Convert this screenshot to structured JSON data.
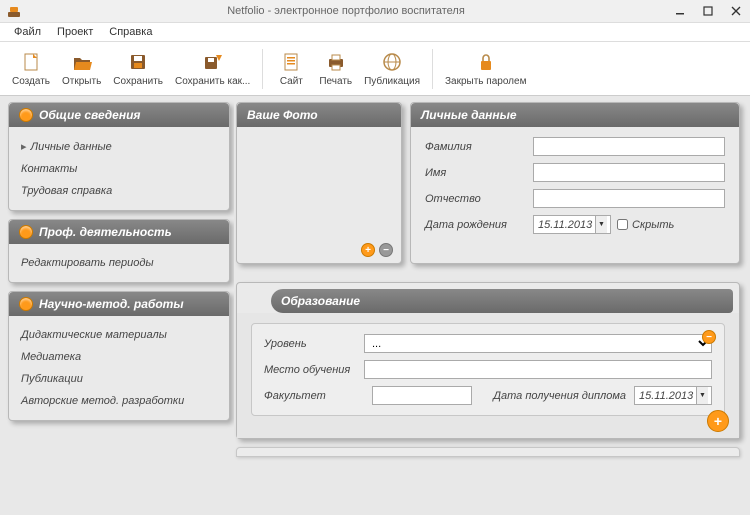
{
  "window": {
    "title": "Netfolio - электронное портфолио воспитателя"
  },
  "menu": {
    "file": "Файл",
    "project": "Проект",
    "help": "Справка"
  },
  "toolbar": {
    "create": "Создать",
    "open": "Открыть",
    "save": "Сохранить",
    "save_as": "Сохранить как...",
    "site": "Сайт",
    "print": "Печать",
    "publish": "Публикация",
    "lock": "Закрыть паролем"
  },
  "sidebar": {
    "groups": [
      {
        "title": "Общие сведения",
        "items": [
          "Личные данные",
          "Контакты",
          "Трудовая справка"
        ],
        "active": 0
      },
      {
        "title": "Проф. деятельность",
        "items": [
          "Редактировать периоды"
        ]
      },
      {
        "title": "Научно-метод. работы",
        "items": [
          "Дидактические материалы",
          "Медиатека",
          "Публикации",
          "Авторские метод. разработки"
        ]
      }
    ]
  },
  "photo": {
    "title": "Ваше Фото"
  },
  "personal": {
    "title": "Личные данные",
    "labels": {
      "surname": "Фамилия",
      "name": "Имя",
      "patronymic": "Отчество",
      "birthdate": "Дата рождения",
      "hide": "Скрыть"
    },
    "values": {
      "surname": "",
      "name": "",
      "patronymic": "",
      "birthdate": "15.11.2013",
      "hide": false
    }
  },
  "education": {
    "title": "Образование",
    "labels": {
      "level": "Уровень",
      "place": "Место обучения",
      "faculty": "Факультет",
      "diploma_date": "Дата получения диплома"
    },
    "values": {
      "level": "...",
      "place": "",
      "faculty": "",
      "diploma_date": "15.11.2013"
    }
  }
}
